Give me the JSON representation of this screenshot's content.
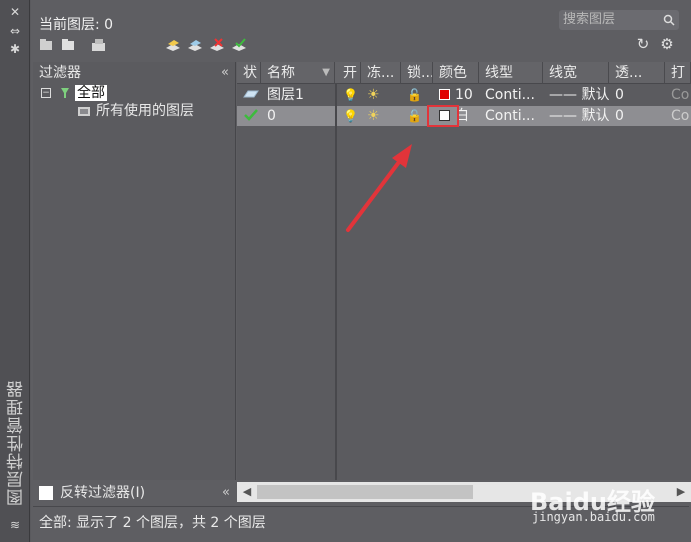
{
  "palette": "vertical-title",
  "vertical_title": "图层特性管理器",
  "header": {
    "current_layer_label": "当前图层: 0",
    "search_placeholder": "搜索图层"
  },
  "filters": {
    "title": "过滤器",
    "tree": [
      {
        "label": "全部",
        "expanded": true
      },
      {
        "label": "所有使用的图层"
      }
    ],
    "invert_label": "反转过滤器(I)"
  },
  "table": {
    "columns": [
      "状",
      "名称",
      "开",
      "冻...",
      "锁...",
      "颜色",
      "线型",
      "线宽",
      "透...",
      "打"
    ],
    "rows": [
      {
        "status_icon": "layer-icon",
        "name": "图层1",
        "color_hex": "#e00000",
        "color_label": "10",
        "linetype": "Conti...",
        "lineweight": "—— 默认",
        "transparency": "0",
        "plot": "Co",
        "selected": false
      },
      {
        "status_icon": "checkmark-icon",
        "name": "0",
        "color_hex": "#ffffff",
        "color_label": "白",
        "linetype": "Conti...",
        "lineweight": "—— 默认",
        "transparency": "0",
        "plot": "Co",
        "selected": true
      }
    ]
  },
  "status": "全部: 显示了 2 个图层，共 2 个图层",
  "watermark": {
    "brand": "Baidu经验",
    "url": "jingyan.baidu.com"
  },
  "colors": {
    "annotation_red": "#e2343a",
    "panel_bg": "#5e5e62"
  }
}
